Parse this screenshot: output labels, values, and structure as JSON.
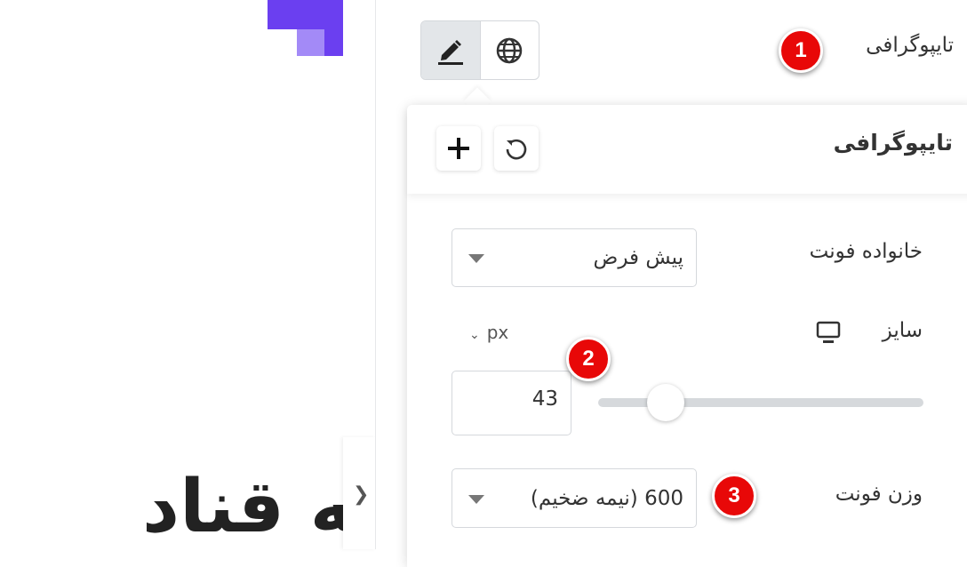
{
  "canvas": {
    "heading_partial": "به قناد"
  },
  "panel": {
    "typography_label": "تایپوگرافی",
    "toggle": {
      "edit_icon": "pencil-icon",
      "global_icon": "globe-icon"
    },
    "popover": {
      "title": "تایپوگرافی",
      "reset_icon": "reset-icon",
      "add_icon": "plus-icon",
      "font_family": {
        "label": "خانواده فونت",
        "value": "پیش فرض"
      },
      "size": {
        "label": "سایز",
        "device_icon": "desktop-icon",
        "unit": "px",
        "value": "43"
      },
      "font_weight": {
        "label": "وزن فونت",
        "value": "600 (نیمه ضخیم)"
      }
    }
  },
  "annotations": {
    "badge_1": "1",
    "badge_2": "2",
    "badge_3": "3"
  },
  "colors": {
    "brand_dark": "#6b3ff0",
    "brand_light": "#a38af7",
    "badge_red": "#e80808"
  }
}
